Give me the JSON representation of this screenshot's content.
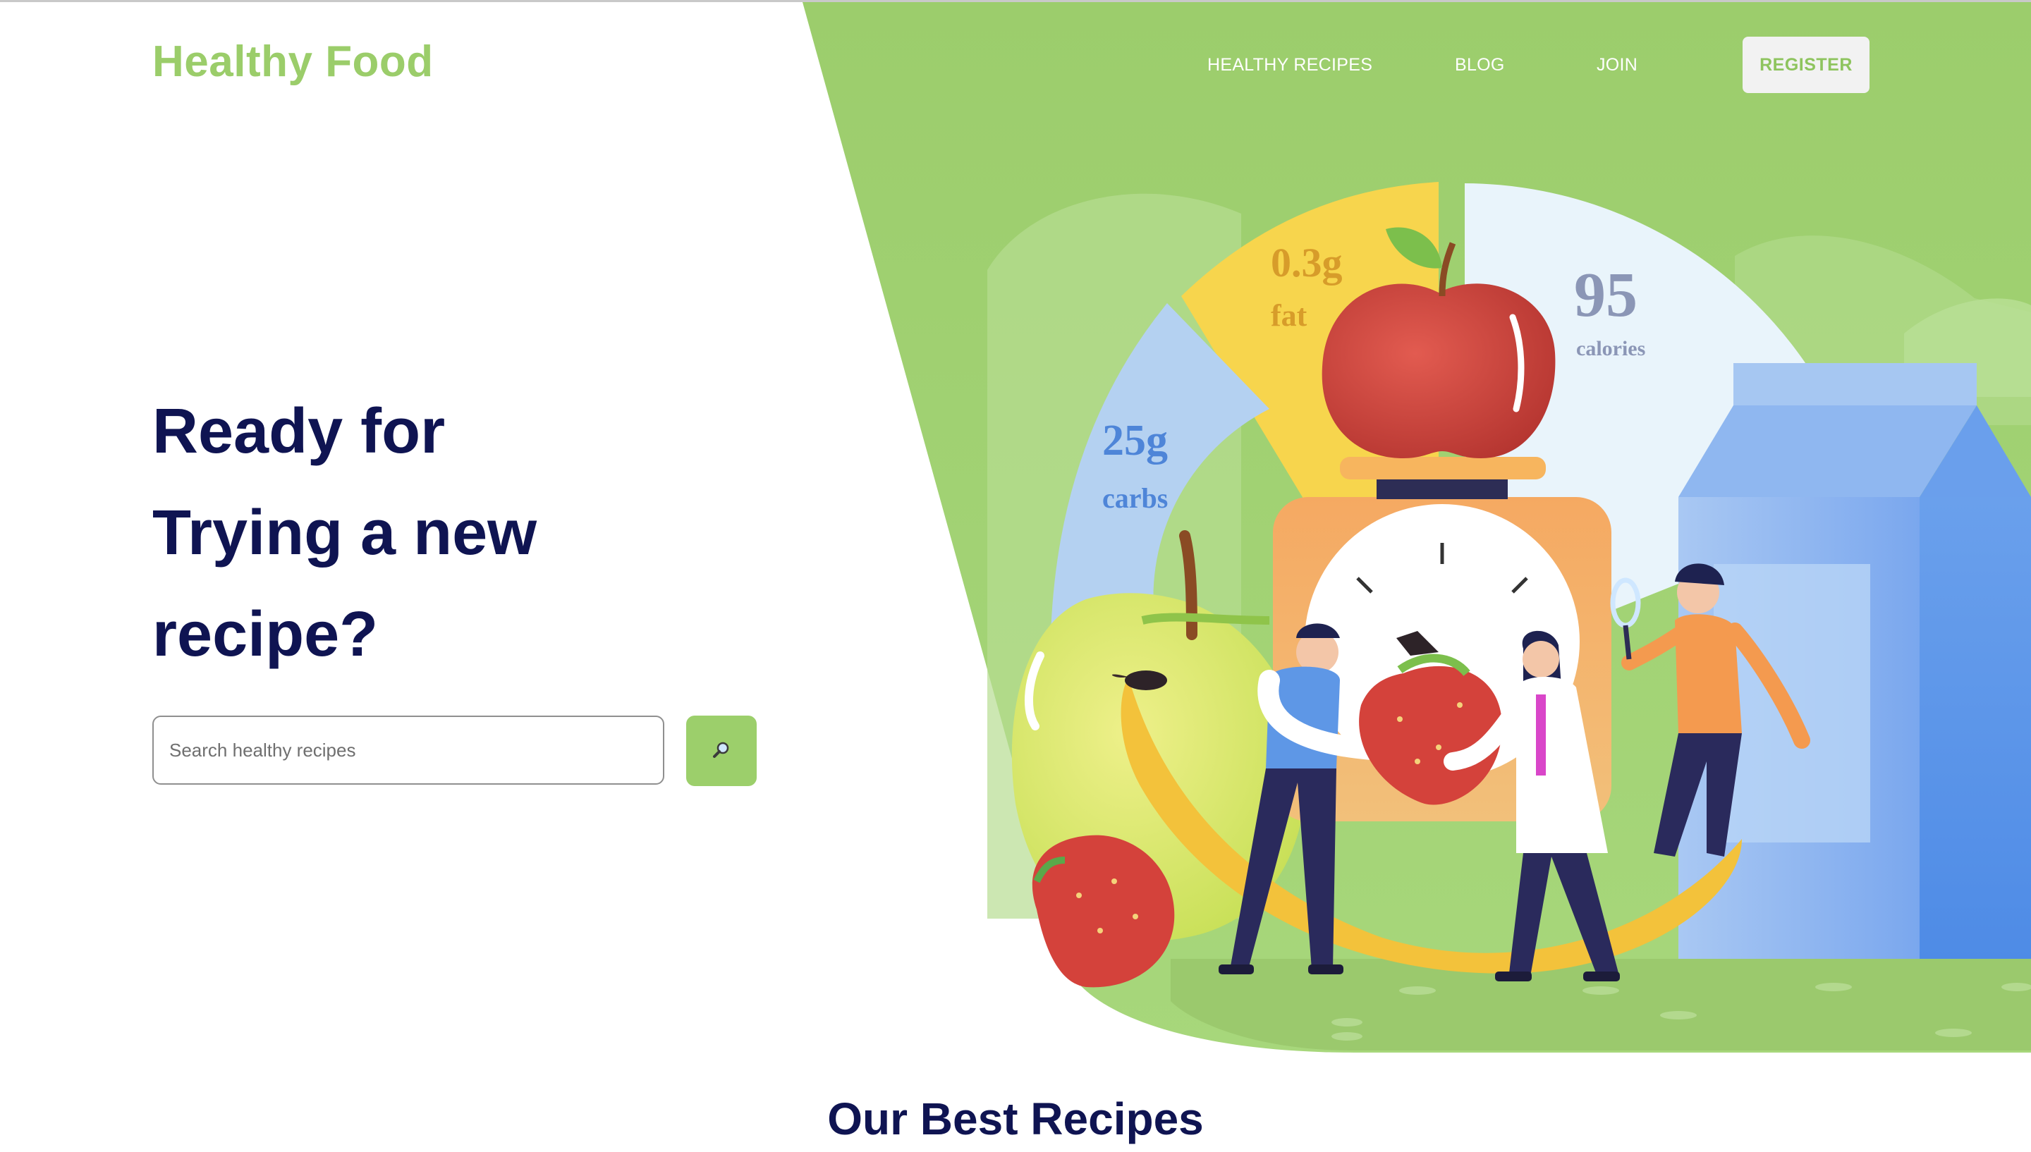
{
  "brand": {
    "name": "Healthy Food",
    "color": "#9bcd6a"
  },
  "nav": {
    "links": [
      "HEALTHY RECIPES",
      "BLOG",
      "JOIN"
    ],
    "register_label": "REGISTER"
  },
  "hero": {
    "headline_lines": [
      "Ready for",
      "Trying a new",
      "recipe?"
    ],
    "search": {
      "placeholder": "Search healthy recipes",
      "value": ""
    },
    "search_button_icon": "search-icon"
  },
  "nutrition": {
    "fat": {
      "value": "0.3g",
      "label": "fat"
    },
    "calories": {
      "value": "95",
      "label": "calories"
    },
    "carbs": {
      "value": "25g",
      "label": "carbs"
    }
  },
  "sections": {
    "best_recipes_title": "Our Best Recipes"
  },
  "colors": {
    "accent": "#9bcd6a",
    "headline": "#0f1452",
    "hero_green": "#9dcf70"
  }
}
